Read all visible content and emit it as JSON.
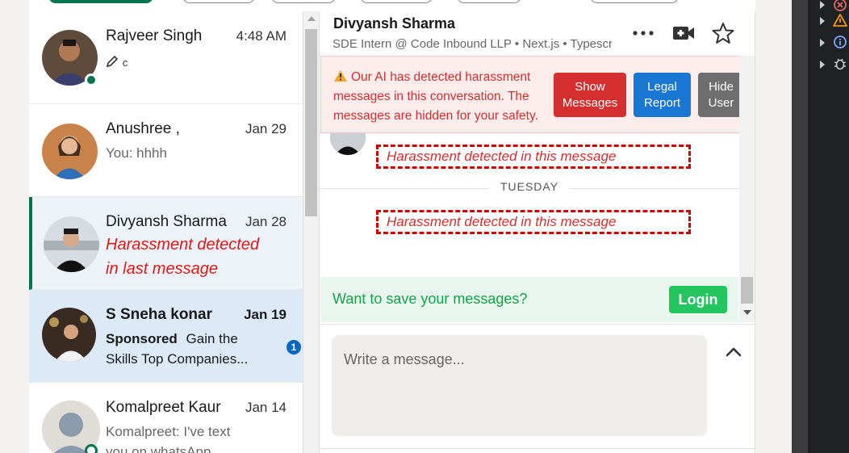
{
  "conversations": [
    {
      "name": "Rajveer Singh",
      "date": "4:48 AM",
      "preview": "c"
    },
    {
      "name": "Anushree ,",
      "date": "Jan 29",
      "preview": "You: hhhh"
    },
    {
      "name": "Divyansh Sharma",
      "date": "Jan 28",
      "preview_line1": "Harassment detected",
      "preview_line2": "in last message"
    },
    {
      "name": "S Sneha konar",
      "date": "Jan 19",
      "sponsored": "Sponsored",
      "preview_a": "Gain the",
      "preview_b": "Skills Top Companies...",
      "badge": "1"
    },
    {
      "name": "Komalpreet Kaur",
      "date": "Jan 14",
      "preview_a": "Komalpreet: I've text",
      "preview_b": "you on whatsApp"
    }
  ],
  "header": {
    "name": "Divyansh Sharma",
    "subtitle": "SDE Intern @ Code Inbound LLP • Next.js • Typescript"
  },
  "warning": {
    "text": "Our AI has detected harassment messages in this conversation. The messages are hidden for your safety.",
    "show_label": "Show Messages",
    "legal_label": "Legal Report",
    "hide_label": "Hide User"
  },
  "messages": {
    "flag_1": "Harassment detected in this message",
    "day_label": "TUESDAY",
    "flag_2": "Harassment detected in this message"
  },
  "save_bar": {
    "text": "Want to save your messages?",
    "login_label": "Login"
  },
  "compose": {
    "placeholder": "Write a message..."
  },
  "colors": {
    "green": "#01754f",
    "alert_red": "#d32f2f",
    "show_btn": "#d32f2f",
    "legal_btn": "#1976d2",
    "hide_btn": "#6e6e6e",
    "login_btn": "#22c55e"
  },
  "icons": {
    "more": "more-horizontal-icon",
    "video": "video-camera-icon",
    "star": "star-icon",
    "warning": "warning-icon",
    "pencil": "pencil-icon",
    "expand": "chevron-up-icon"
  }
}
